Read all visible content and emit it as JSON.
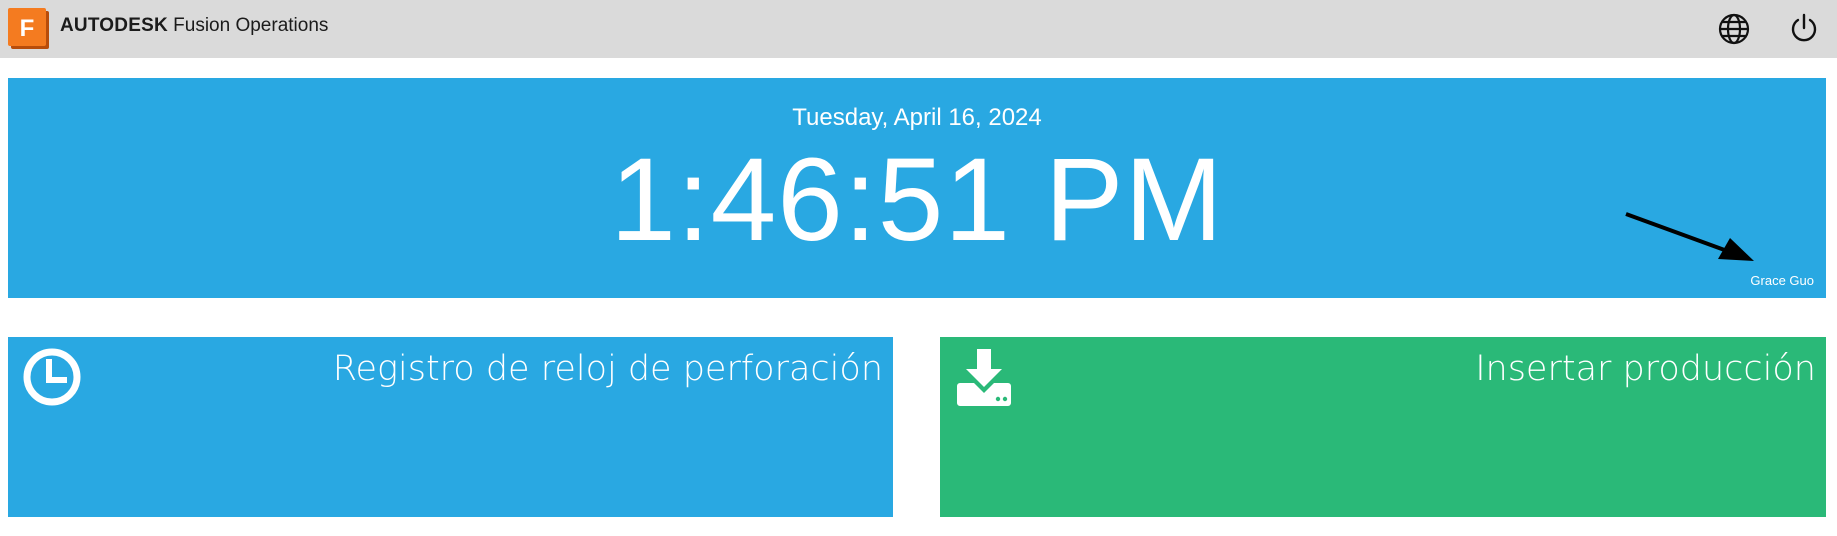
{
  "header": {
    "logo_letter": "F",
    "brand_bold": "AUTODESK",
    "brand_product": "Fusion Operations",
    "globe_icon": "globe-icon",
    "power_icon": "power-icon"
  },
  "clock": {
    "date": "Tuesday, April 16, 2024",
    "time": "1:46:51 PM",
    "user": "Grace Guo",
    "annotation_icon": "arrow-icon"
  },
  "tiles": [
    {
      "label": "Registro de reloj de perforación",
      "icon": "clock-icon",
      "color": "#29a8e2"
    },
    {
      "label": "Insertar producción",
      "icon": "download-drive-icon",
      "color": "#2ab978"
    }
  ],
  "colors": {
    "topbar": "#dadada",
    "accent_blue": "#29a8e2",
    "accent_green": "#2ab978",
    "logo_orange": "#f47b20"
  }
}
